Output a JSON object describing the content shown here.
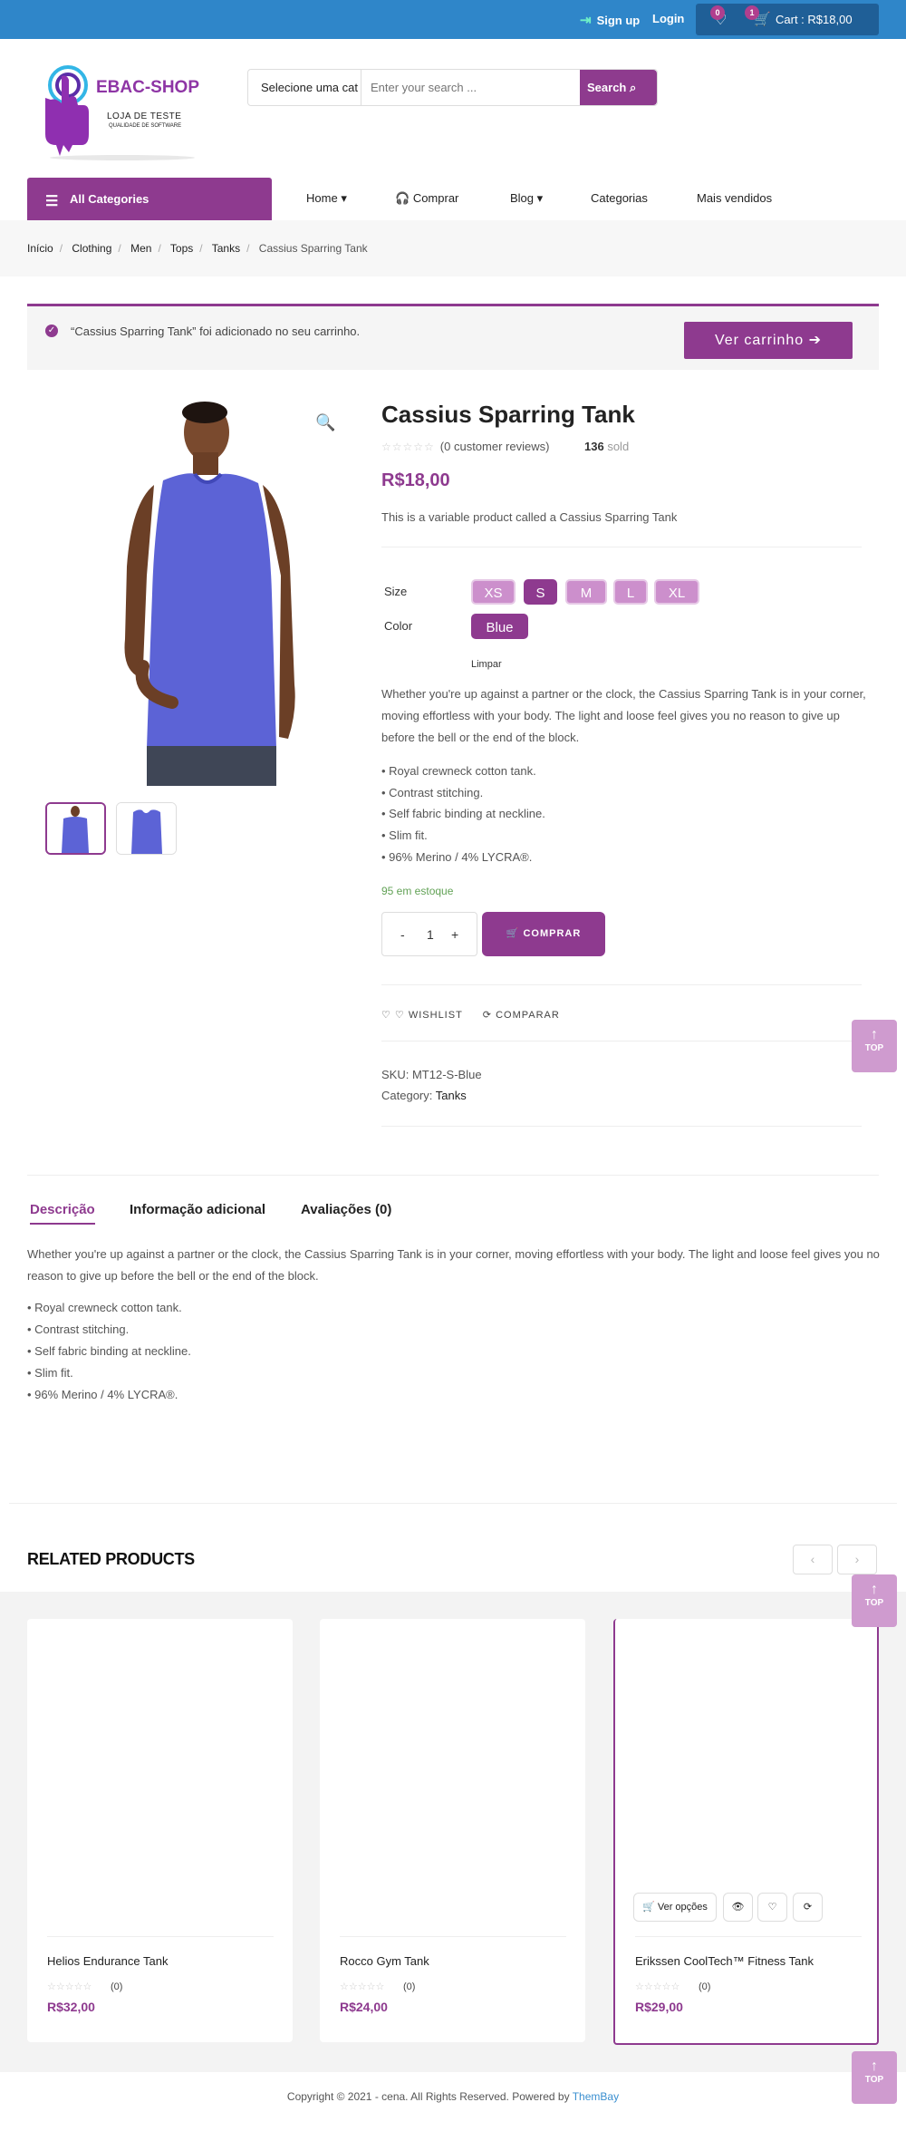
{
  "topbar": {
    "signup": "Sign up",
    "login": "Login",
    "wishlist_count": "0",
    "cart_count": "1",
    "cart_label": "Cart : R$18,00"
  },
  "header": {
    "logo_brand": "EBAC-SHOP",
    "logo_tag1": "LOJA DE TESTE",
    "logo_tag2": "QUALIDADE DE SOFTWARE",
    "search_category": "Selecione uma cat",
    "search_placeholder": "Enter your search ...",
    "search_button": "Search"
  },
  "nav": {
    "all_categories": "All Categories",
    "items": [
      "Home",
      "Comprar",
      "Blog",
      "Categorias",
      "Mais vendidos"
    ]
  },
  "breadcrumb": [
    "Início",
    "Clothing",
    "Men",
    "Tops",
    "Tanks",
    "Cassius Sparring Tank"
  ],
  "notice": {
    "message": "“Cassius Sparring Tank” foi adicionado no seu carrinho.",
    "button": "Ver carrinho"
  },
  "product": {
    "title": "Cassius Sparring Tank",
    "reviews": "(0 customer reviews)",
    "sold_count": "136",
    "sold_label": "sold",
    "price": "R$18,00",
    "short_description": "This is a variable product called a Cassius Sparring Tank",
    "size_label": "Size",
    "sizes": [
      "XS",
      "S",
      "M",
      "L",
      "XL"
    ],
    "selected_size": "S",
    "color_label": "Color",
    "colors": [
      "Blue"
    ],
    "selected_color": "Blue",
    "clear": "Limpar",
    "description": "Whether you're up against a partner or the clock, the Cassius Sparring Tank is in your corner, moving effortless with your body. The light and loose feel gives you no reason to give up before the bell or the end of the block.",
    "features": [
      "• Royal crewneck cotton tank.",
      "• Contrast stitching.",
      "• Self fabric binding at neckline.",
      "• Slim fit.",
      "• 96% Merino / 4% LYCRA®."
    ],
    "stock": "95 em estoque",
    "quantity": "1",
    "buy_button": "COMPRAR",
    "wishlist": "WISHLIST",
    "compare": "COMPARAR",
    "sku_label": "SKU:",
    "sku": "MT12-S-Blue",
    "category_label": "Category:",
    "category": "Tanks",
    "shirt_color": "#5c63d6"
  },
  "top_button": "TOP",
  "tabs": {
    "items": [
      "Descrição",
      "Informação adicional",
      "Avaliações (0)"
    ],
    "active": 0,
    "description": "Whether you're up against a partner or the clock, the Cassius Sparring Tank is in your corner, moving effortless with your body. The light and loose feel gives you no reason to give up before the bell or the end of the block.",
    "features": [
      "• Royal crewneck cotton tank.",
      "• Contrast stitching.",
      "• Self fabric binding at neckline.",
      "• Slim fit.",
      "• 96% Merino / 4% LYCRA®."
    ]
  },
  "related": {
    "heading": "RELATED PRODUCTS",
    "products": [
      {
        "name": "Helios Endurance Tank",
        "reviews": "(0)",
        "price": "R$32,00"
      },
      {
        "name": "Rocco Gym Tank",
        "reviews": "(0)",
        "price": "R$24,00"
      },
      {
        "name": "Erikssen CoolTech™ Fitness Tank",
        "reviews": "(0)",
        "price": "R$29,00",
        "options_button": "Ver opções"
      }
    ]
  },
  "footer": {
    "copyright": "Copyright © 2021 - cena. All Rights Reserved. Powered by",
    "powered": "ThemBay"
  },
  "colors": {
    "primary": "#8e3a8f",
    "topbar": "#2f86c9",
    "stock": "#62a256"
  }
}
